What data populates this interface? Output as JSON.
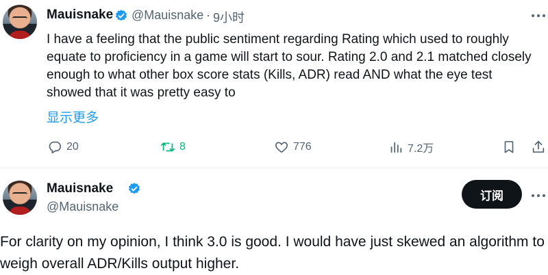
{
  "tweet": {
    "author_name": "Mauisnake",
    "handle": "@Mauisnake",
    "separator": "·",
    "time": "9小时",
    "text": "I have a feeling that the public sentiment regarding Rating which used to roughly equate to proficiency in a game will start to sour. Rating 2.0 and 2.1 matched closely enough to what other box score stats (Kills, ADR) read AND what the eye test showed that it was pretty easy to",
    "show_more": "显示更多",
    "stats": {
      "replies": "20",
      "retweets": "8",
      "likes": "776",
      "views": "7.2万"
    },
    "icons": [
      "reply-icon",
      "retweet-icon",
      "like-icon",
      "views-icon",
      "bookmark-icon",
      "share-icon",
      "more-icon",
      "verified-badge-icon"
    ]
  },
  "reply_tweet": {
    "author_name": "Mauisnake",
    "handle": "@Mauisnake",
    "follow_label": "订阅",
    "text": "For clarity on my opinion, I think 3.0 is good. I would have just skewed an algorithm to weigh overall ADR/Kills output higher."
  },
  "colors": {
    "accent": "#1d9bf0",
    "retweet_green": "#00ba7c",
    "muted": "#536471",
    "text": "#0f1419"
  }
}
